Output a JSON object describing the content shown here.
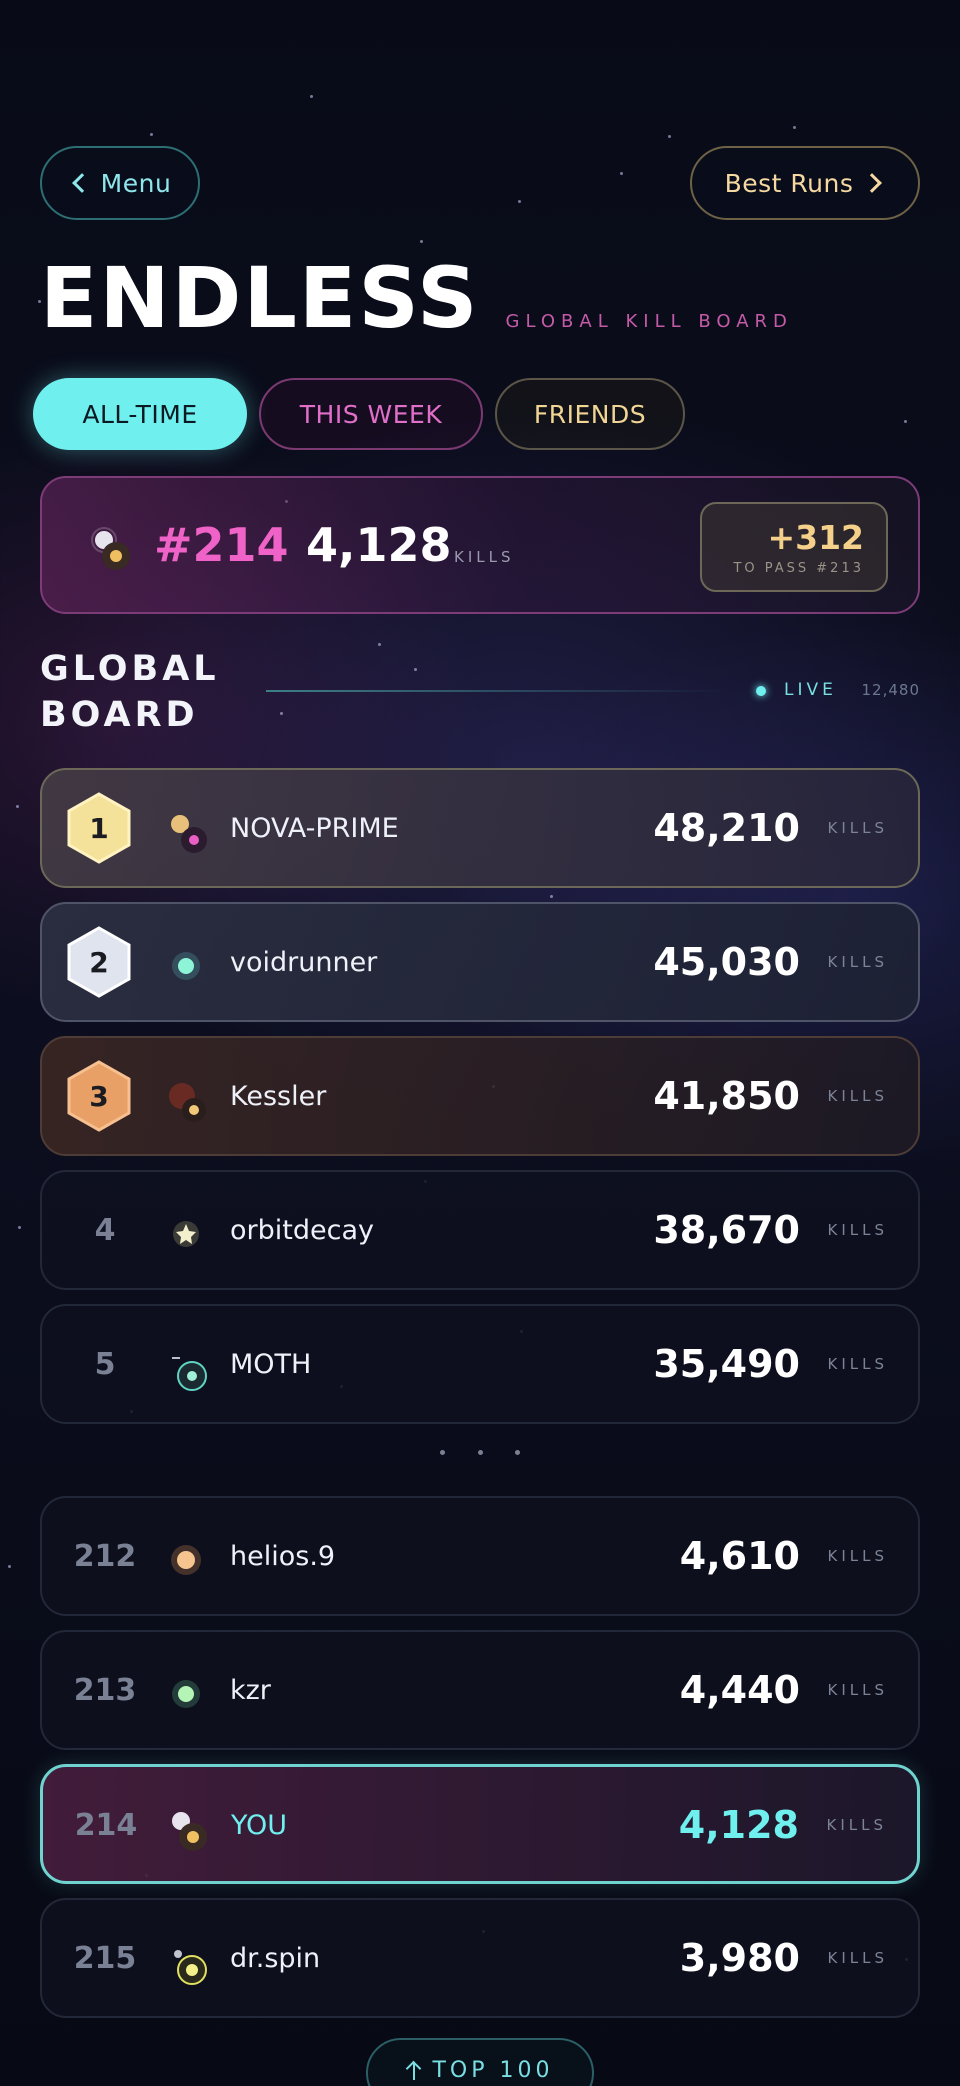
{
  "nav": {
    "menu_label": "Menu",
    "best_runs_label": "Best Runs"
  },
  "header": {
    "title": "ENDLESS",
    "subtitle": "GLOBAL KILL BOARD"
  },
  "tabs": [
    {
      "label": "ALL-TIME",
      "active": true
    },
    {
      "label": "THIS WEEK",
      "active": false
    },
    {
      "label": "FRIENDS",
      "active": false
    }
  ],
  "my_stats": {
    "rank": "#214",
    "kills": "4,128",
    "kills_label": "KILLS",
    "to_pass_value": "+312",
    "to_pass_label": "TO PASS #213"
  },
  "board": {
    "title_line1": "GLOBAL",
    "title_line2": "BOARD",
    "live_label": "LIVE",
    "live_count": "12,480"
  },
  "top_rows": [
    {
      "rank": "1",
      "name": "NOVA-PRIME",
      "kills": "48,210",
      "label": "KILLS",
      "tier": "gold",
      "avatar": "double-planet-gold-pink"
    },
    {
      "rank": "2",
      "name": "voidrunner",
      "kills": "45,030",
      "label": "KILLS",
      "tier": "silver",
      "avatar": "cyan-star"
    },
    {
      "rank": "3",
      "name": "Kessler",
      "kills": "41,850",
      "label": "KILLS",
      "tier": "bronze",
      "avatar": "red-planet-with-moon"
    },
    {
      "rank": "4",
      "name": "orbitdecay",
      "kills": "38,670",
      "label": "KILLS",
      "tier": "none",
      "avatar": "white-star"
    },
    {
      "rank": "5",
      "name": "MOTH",
      "kills": "35,490",
      "label": "KILLS",
      "tier": "none",
      "avatar": "teal-orbit"
    }
  ],
  "near_rows": [
    {
      "rank": "212",
      "name": "helios.9",
      "kills": "4,610",
      "label": "KILLS",
      "avatar": "orange-sun"
    },
    {
      "rank": "213",
      "name": "kzr",
      "kills": "4,440",
      "label": "KILLS",
      "avatar": "green-star"
    },
    {
      "rank": "214",
      "name": "YOU",
      "kills": "4,128",
      "label": "KILLS",
      "avatar": "double-planet-white-gold",
      "is_you": true
    },
    {
      "rank": "215",
      "name": "dr.spin",
      "kills": "3,980",
      "label": "KILLS",
      "avatar": "yellow-planet-with-moon"
    }
  ],
  "footer": {
    "top100_label": "TOP 100"
  },
  "colors": {
    "accent_cyan": "#6ff0ef",
    "accent_pink": "#ef63c8",
    "accent_gold": "#f4d08a",
    "background": "#0b0d1c"
  }
}
